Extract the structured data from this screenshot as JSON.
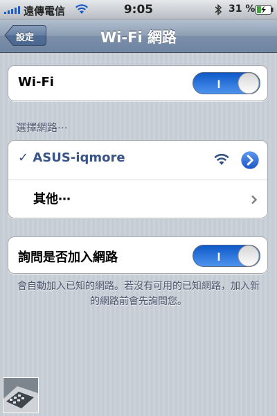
{
  "status_bar": {
    "carrier": "遠傳電信",
    "time": "9:05",
    "battery_percent": "31 %",
    "battery_level": 0.31,
    "icons": [
      "signal-bars-icon",
      "wifi-status-icon",
      "bluetooth-icon",
      "battery-charging-icon"
    ]
  },
  "nav": {
    "back_label": "設定",
    "title": "Wi-Fi 網路"
  },
  "wifi_toggle": {
    "label": "Wi-Fi",
    "on": true,
    "on_text": "I"
  },
  "networks": {
    "section_header": "選擇網路⋯",
    "connected": {
      "checkmark": "✓",
      "name": "ASUS-iqmore"
    },
    "other_label": "其他⋯"
  },
  "ask_toggle": {
    "label": "詢問是否加入網路",
    "on": true,
    "on_text": "I",
    "footer": "會自動加入已知的網路。若沒有可用的已知網路，加入新的網路前會先詢問您。"
  },
  "colors": {
    "toggle_blue": "#1d6ad8",
    "checked_text": "#385487",
    "background": "#c5ccd4",
    "nav_bar": "#6d84a2"
  }
}
